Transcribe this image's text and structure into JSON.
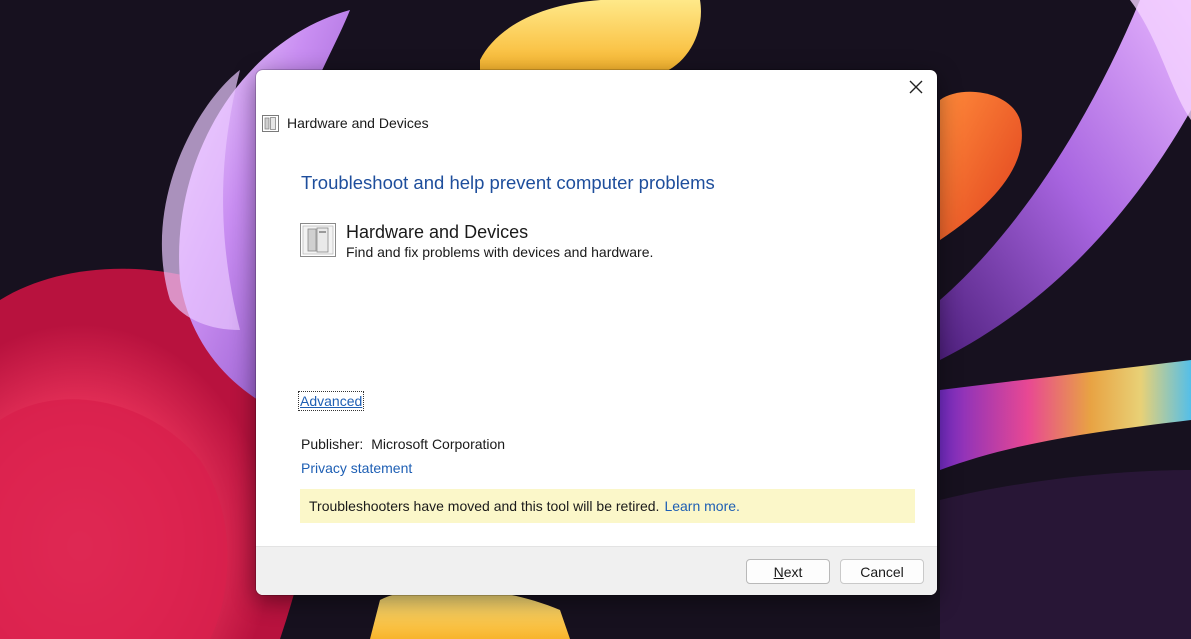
{
  "dialog": {
    "title": "Hardware and Devices",
    "heading": "Troubleshoot and help prevent computer problems",
    "item": {
      "title": "Hardware and Devices",
      "description": "Find and fix problems with devices and hardware."
    },
    "advanced_label": "Advanced",
    "publisher_label": "Publisher:",
    "publisher_value": "Microsoft Corporation",
    "privacy_label": "Privacy statement",
    "notice": {
      "text": "Troubleshooters have moved and this tool will be retired.",
      "link": "Learn more."
    },
    "buttons": {
      "next": "Next",
      "cancel": "Cancel"
    }
  },
  "icons": {
    "close": "close-icon",
    "app": "hardware-devices-icon"
  },
  "colors": {
    "heading": "#1e4e9c",
    "link": "#1e5fb4",
    "notice_bg": "#fbf7c9",
    "footer_bg": "#f0f0f0"
  }
}
